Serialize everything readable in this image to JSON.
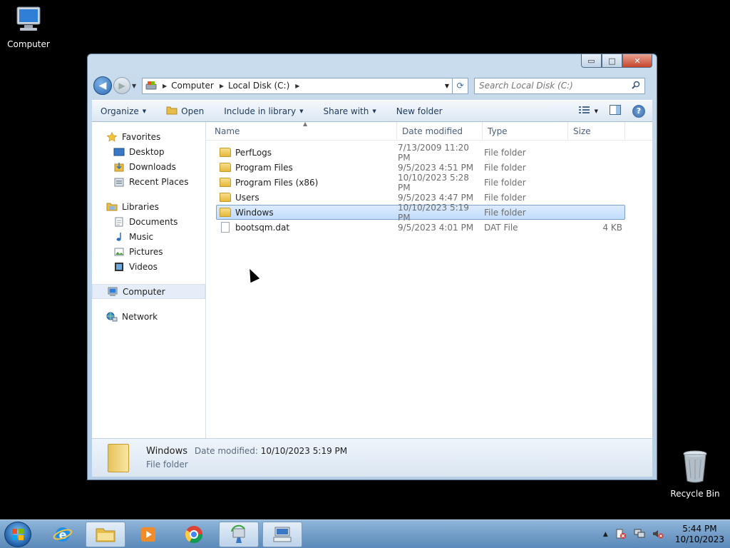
{
  "desktop": {
    "computer_label": "Computer",
    "recycle_label": "Recycle Bin"
  },
  "window": {
    "caption": {
      "minimize": "▭",
      "maximize": "□",
      "close": "✕"
    },
    "address": {
      "crumbs": [
        "Computer",
        "Local Disk (C:)"
      ]
    },
    "search": {
      "placeholder": "Search Local Disk (C:)"
    },
    "toolbar": {
      "organize": "Organize",
      "open": "Open",
      "include": "Include in library",
      "share": "Share with",
      "new_folder": "New folder"
    },
    "nav": {
      "favorites": "Favorites",
      "favorites_items": [
        "Desktop",
        "Downloads",
        "Recent Places"
      ],
      "libraries": "Libraries",
      "libraries_items": [
        "Documents",
        "Music",
        "Pictures",
        "Videos"
      ],
      "computer": "Computer",
      "network": "Network"
    },
    "columns": {
      "name": "Name",
      "date": "Date modified",
      "type": "Type",
      "size": "Size"
    },
    "files": [
      {
        "name": "PerfLogs",
        "date": "7/13/2009 11:20 PM",
        "type": "File folder",
        "size": "",
        "kind": "folder"
      },
      {
        "name": "Program Files",
        "date": "9/5/2023 4:51 PM",
        "type": "File folder",
        "size": "",
        "kind": "folder"
      },
      {
        "name": "Program Files (x86)",
        "date": "10/10/2023 5:28 PM",
        "type": "File folder",
        "size": "",
        "kind": "folder"
      },
      {
        "name": "Users",
        "date": "9/5/2023 4:47 PM",
        "type": "File folder",
        "size": "",
        "kind": "folder"
      },
      {
        "name": "Windows",
        "date": "10/10/2023 5:19 PM",
        "type": "File folder",
        "size": "",
        "kind": "folder"
      },
      {
        "name": "bootsqm.dat",
        "date": "9/5/2023 4:01 PM",
        "type": "DAT File",
        "size": "4 KB",
        "kind": "file"
      }
    ],
    "details": {
      "name": "Windows",
      "date_key": "Date modified:",
      "date_val": "10/10/2023 5:19 PM",
      "type": "File folder"
    }
  },
  "taskbar": {
    "time": "5:44 PM",
    "date": "10/10/2023"
  }
}
